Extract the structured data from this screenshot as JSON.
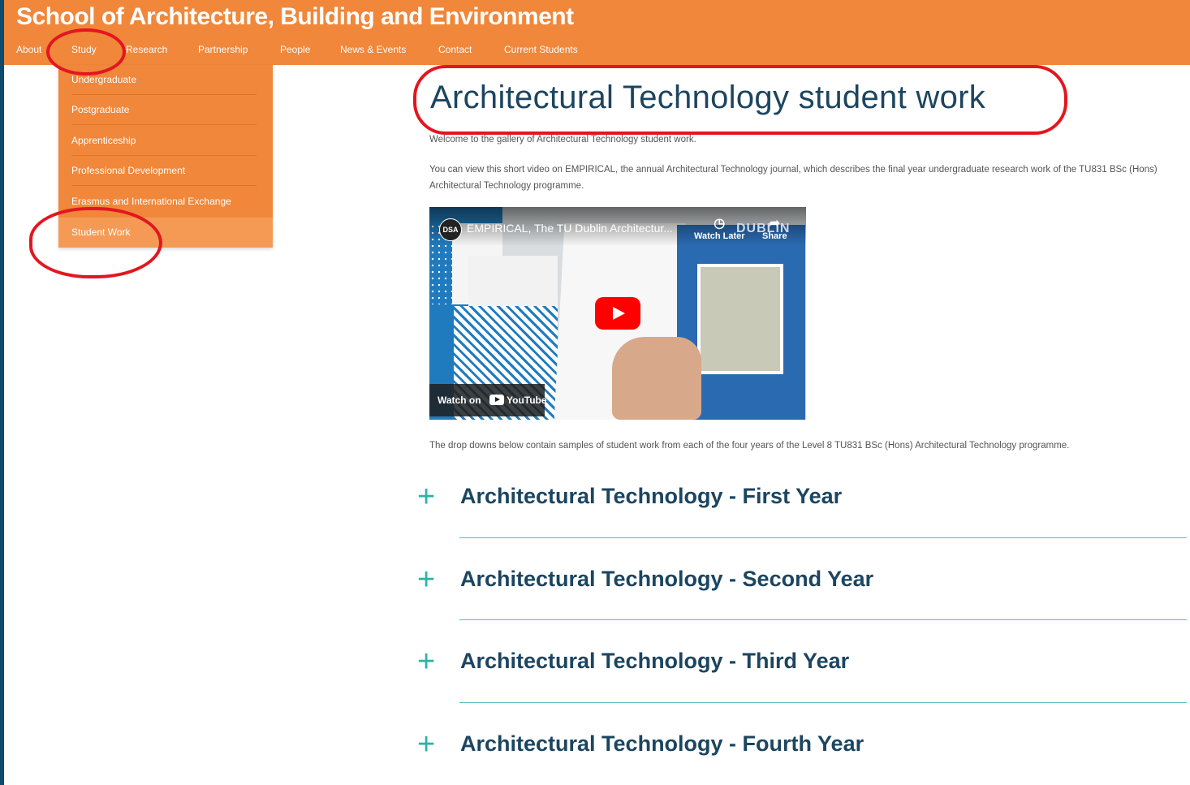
{
  "header": {
    "site_title": "School of Architecture, Building and Environment",
    "nav": [
      "About",
      "Study",
      "Research",
      "Partnership",
      "People",
      "News & Events",
      "Contact",
      "Current Students"
    ]
  },
  "dropdown": {
    "items": [
      "Undergraduate",
      "Postgraduate",
      "Apprenticeship",
      "Professional Development",
      "Erasmus and International Exchange",
      "Student Work"
    ],
    "active": "Student Work"
  },
  "main": {
    "title": "Architectural Technology student work",
    "intro": "Welcome to the gallery of Architectural Technology student work.",
    "video_text": "You can view this short video on EMPIRICAL, the annual Architectural Technology journal, which describes the final year undergraduate research work of the TU831 BSc (Hons) Architectural Technology programme.",
    "dropdowns_text": "The drop downs below contain samples of student work from each of the four years of the Level 8 TU831 BSc (Hons) Architectural Technology programme."
  },
  "video": {
    "channel_logo": "DSA",
    "title": "EMPIRICAL, The TU Dublin Architectur...",
    "watch_later": "Watch Later",
    "share": "Share",
    "brand": "DUBLIN",
    "watch_on": "Watch on",
    "youtube": "YouTube"
  },
  "accordion": [
    "Architectural Technology - First Year",
    "Architectural Technology - Second Year",
    "Architectural Technology - Third Year",
    "Architectural Technology - Fourth Year"
  ],
  "colors": {
    "header": "#f0873a",
    "title": "#1c4560",
    "accent": "#2bb3a6",
    "annotation": "#e3161f"
  }
}
